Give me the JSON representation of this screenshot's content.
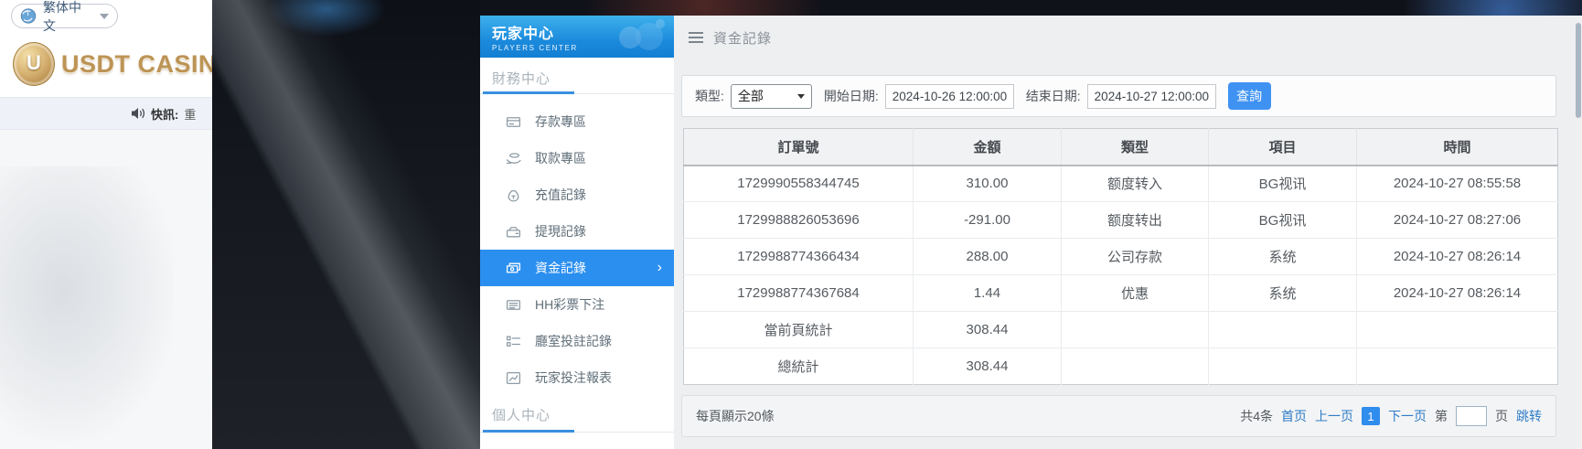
{
  "colors": {
    "accent_blue": "#2b8ff0",
    "link_blue": "#2e7cc8",
    "logo_gold": "#bd9455",
    "sidebar_header_blue": "#1b8adc"
  },
  "top_left": {
    "language_selector": {
      "label": "繁体中文",
      "icon": "globe-icon",
      "caret_icon": "caret-down-icon"
    },
    "logo": {
      "text": "USDT CASINO",
      "coin_letter": "U",
      "icon": "usdt-coin-logo"
    },
    "news_ticker": {
      "icon": "speaker-icon",
      "label": "快訊:",
      "text": "重"
    }
  },
  "sidebar": {
    "title": "玩家中心",
    "subtitle": "PLAYERS CENTER",
    "watermark_icon": "game-controller-icon",
    "section_finance": "財務中心",
    "section_personal": "個人中心",
    "items": [
      {
        "id": "deposit-zone",
        "label": "存款專區",
        "icon": "deposit-card-icon",
        "active": false
      },
      {
        "id": "withdraw-zone",
        "label": "取款專區",
        "icon": "withdraw-hand-icon",
        "active": false
      },
      {
        "id": "recharge-record",
        "label": "充值記錄",
        "icon": "moneybag-icon",
        "active": false
      },
      {
        "id": "withdraw-record",
        "label": "提現記錄",
        "icon": "purse-icon",
        "active": false
      },
      {
        "id": "funds-record",
        "label": "資金記錄",
        "icon": "banknotes-icon",
        "active": true
      },
      {
        "id": "lottery-bet",
        "label": "HH彩票下注",
        "icon": "ticket-list-icon",
        "active": false
      },
      {
        "id": "room-bet-record",
        "label": "廳室投註記錄",
        "icon": "list-detail-icon",
        "active": false
      },
      {
        "id": "player-bet-report",
        "label": "玩家投注報表",
        "icon": "report-chart-icon",
        "active": false
      }
    ]
  },
  "main": {
    "title": "資金記錄",
    "menu_icon": "hamburger-icon",
    "filters": {
      "type_label": "類型:",
      "type_value": "全部",
      "start_label": "開始日期:",
      "start_value": "2024-10-26 12:00:00",
      "end_label": "结束日期:",
      "end_value": "2024-10-27 12:00:00",
      "search_button": "查詢"
    },
    "table": {
      "columns": [
        "訂單號",
        "金額",
        "類型",
        "項目",
        "時間"
      ],
      "rows": [
        [
          "1729990558344745",
          "310.00",
          "额度转入",
          "BG视讯",
          "2024-10-27 08:55:58"
        ],
        [
          "1729988826053696",
          "-291.00",
          "额度转出",
          "BG视讯",
          "2024-10-27 08:27:06"
        ],
        [
          "1729988774366434",
          "288.00",
          "公司存款",
          "系统",
          "2024-10-27 08:26:14"
        ],
        [
          "1729988774367684",
          "1.44",
          "优惠",
          "系统",
          "2024-10-27 08:26:14"
        ],
        [
          "當前頁統計",
          "308.44",
          "",
          "",
          ""
        ],
        [
          "總統計",
          "308.44",
          "",
          "",
          ""
        ]
      ]
    },
    "pagination": {
      "page_size_text": "每頁顯示20條",
      "total_text": "共4条",
      "first": "首页",
      "prev": "上一页",
      "current_page": "1",
      "next": "下一页",
      "jump_prefix": "第",
      "jump_suffix": "页",
      "jump_button": "跳转",
      "jump_input_value": ""
    }
  }
}
